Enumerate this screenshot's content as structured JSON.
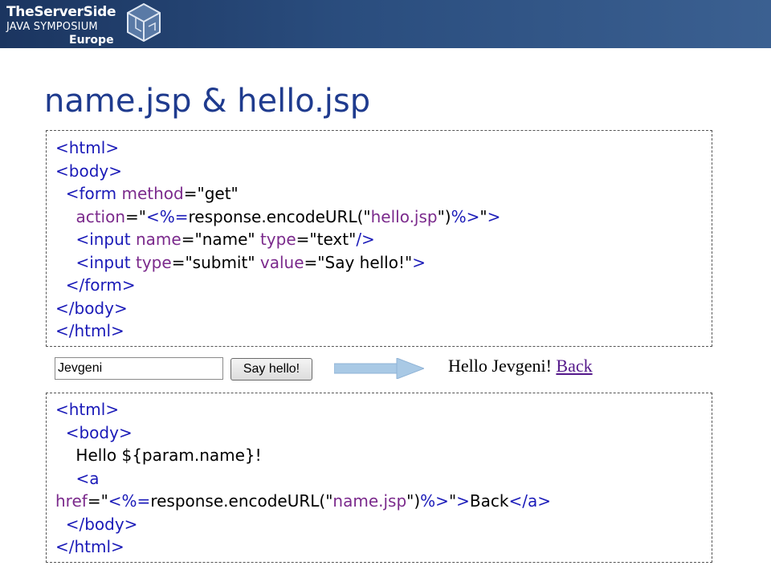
{
  "header": {
    "logo_line1": "TheServerSide",
    "logo_line2": "JAVA SYMPOSIUM",
    "logo_line3": "Europe",
    "background": "#2a4d7e",
    "logo_icon": "cube-icon"
  },
  "slide": {
    "title": "name.jsp & hello.jsp",
    "title_color": "#1f3b8e"
  },
  "code_colors": {
    "tag": "#1a1ab8",
    "attribute": "#7b2a8c",
    "text": "#000000"
  },
  "name_jsp_lines": [
    [
      {
        "t": "tag",
        "v": "<html>"
      }
    ],
    [
      {
        "t": "tag",
        "v": "<body>"
      }
    ],
    [
      {
        "t": "plain",
        "v": "  "
      },
      {
        "t": "tag",
        "v": "<form "
      },
      {
        "t": "attr",
        "v": "method"
      },
      {
        "t": "plain",
        "v": "=\""
      },
      {
        "t": "str",
        "v": "get"
      },
      {
        "t": "plain",
        "v": "\""
      }
    ],
    [
      {
        "t": "plain",
        "v": "    "
      },
      {
        "t": "attr",
        "v": "action"
      },
      {
        "t": "plain",
        "v": "=\""
      },
      {
        "t": "tag",
        "v": "<%="
      },
      {
        "t": "str",
        "v": "response.encodeURL(\""
      },
      {
        "t": "attr",
        "v": "hello.jsp"
      },
      {
        "t": "str",
        "v": "\")"
      },
      {
        "t": "tag",
        "v": "%>"
      },
      {
        "t": "plain",
        "v": "\""
      },
      {
        "t": "tag",
        "v": ">"
      }
    ],
    [
      {
        "t": "plain",
        "v": "    "
      },
      {
        "t": "tag",
        "v": "<input "
      },
      {
        "t": "attr",
        "v": "name"
      },
      {
        "t": "plain",
        "v": "=\""
      },
      {
        "t": "str",
        "v": "name"
      },
      {
        "t": "plain",
        "v": "\" "
      },
      {
        "t": "attr",
        "v": "type"
      },
      {
        "t": "plain",
        "v": "=\""
      },
      {
        "t": "str",
        "v": "text"
      },
      {
        "t": "plain",
        "v": "\""
      },
      {
        "t": "tag",
        "v": "/>"
      }
    ],
    [
      {
        "t": "plain",
        "v": "    "
      },
      {
        "t": "tag",
        "v": "<input "
      },
      {
        "t": "attr",
        "v": "type"
      },
      {
        "t": "plain",
        "v": "=\""
      },
      {
        "t": "str",
        "v": "submit"
      },
      {
        "t": "plain",
        "v": "\" "
      },
      {
        "t": "attr",
        "v": "value"
      },
      {
        "t": "plain",
        "v": "=\""
      },
      {
        "t": "str",
        "v": "Say hello!"
      },
      {
        "t": "plain",
        "v": "\""
      },
      {
        "t": "tag",
        "v": ">"
      }
    ],
    [
      {
        "t": "plain",
        "v": "  "
      },
      {
        "t": "tag",
        "v": "</form>"
      }
    ],
    [
      {
        "t": "tag",
        "v": "</body>"
      }
    ],
    [
      {
        "t": "tag",
        "v": "</html>"
      }
    ]
  ],
  "demo": {
    "input_value": "Jevgeni",
    "button_label": "Say hello!",
    "result_text": "Hello Jevgeni! ",
    "result_link": "Back",
    "arrow_icon": "right-arrow-icon"
  },
  "hello_jsp_lines": [
    [
      {
        "t": "tag",
        "v": "<html>"
      }
    ],
    [
      {
        "t": "plain",
        "v": "  "
      },
      {
        "t": "tag",
        "v": "<body>"
      }
    ],
    [
      {
        "t": "plain",
        "v": "    Hello ${param.name}!"
      }
    ],
    [
      {
        "t": "plain",
        "v": "    "
      },
      {
        "t": "tag",
        "v": "<a"
      }
    ],
    [
      {
        "t": "attr",
        "v": "href"
      },
      {
        "t": "plain",
        "v": "=\""
      },
      {
        "t": "tag",
        "v": "<%="
      },
      {
        "t": "str",
        "v": "response.encodeURL(\""
      },
      {
        "t": "attr",
        "v": "name.jsp"
      },
      {
        "t": "str",
        "v": "\")"
      },
      {
        "t": "tag",
        "v": "%>"
      },
      {
        "t": "plain",
        "v": "\""
      },
      {
        "t": "tag",
        "v": ">"
      },
      {
        "t": "plain",
        "v": "Back"
      },
      {
        "t": "tag",
        "v": "</a>"
      }
    ],
    [
      {
        "t": "plain",
        "v": "  "
      },
      {
        "t": "tag",
        "v": "</body>"
      }
    ],
    [
      {
        "t": "tag",
        "v": "</html>"
      }
    ]
  ]
}
